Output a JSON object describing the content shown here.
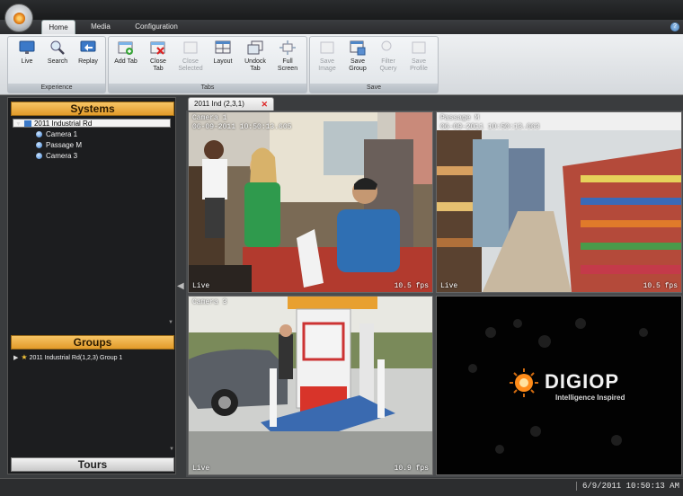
{
  "ribbon_tabs": [
    {
      "label": "Home"
    },
    {
      "label": "Media"
    },
    {
      "label": "Configuration"
    }
  ],
  "help_label": "?",
  "ribbon_groups": {
    "experience": {
      "label": "Experience",
      "buttons": [
        {
          "label": "Live",
          "icon": "monitor-icon"
        },
        {
          "label": "Search",
          "icon": "magnifier-icon"
        },
        {
          "label": "Replay",
          "icon": "replay-icon"
        }
      ]
    },
    "tabs": {
      "label": "Tabs",
      "buttons": [
        {
          "label": "Add Tab",
          "icon": "add-tab-icon"
        },
        {
          "label": "Close Tab",
          "icon": "close-tab-icon"
        },
        {
          "label": "Close Selected",
          "icon": "close-selected-icon"
        },
        {
          "label": "Layout",
          "icon": "layout-icon"
        },
        {
          "label": "Undock Tab",
          "icon": "undock-icon"
        },
        {
          "label": "Full Screen",
          "icon": "fullscreen-icon"
        }
      ]
    },
    "save": {
      "label": "Save",
      "buttons": [
        {
          "label": "Save Image",
          "icon": "save-image-icon"
        },
        {
          "label": "Save Group",
          "icon": "save-group-icon"
        },
        {
          "label": "Filter Query",
          "icon": "filter-icon"
        },
        {
          "label": "Save Profile",
          "icon": "save-profile-icon"
        }
      ]
    }
  },
  "systems": {
    "header": "Systems",
    "site": "2011 Industrial Rd",
    "cameras": [
      "Camera 1",
      "Passage M",
      "Camera 3"
    ]
  },
  "groups": {
    "header": "Groups",
    "item": "2011 Industrial Rd(1,2,3) Group 1"
  },
  "tours": {
    "header": "Tours"
  },
  "video_tab": {
    "label": "2011 Ind (2,3,1)",
    "close": "✕"
  },
  "tiles": [
    {
      "name": "Camera 1",
      "timestamp": "06-09-2011 10:50:13.605",
      "mode": "Live",
      "fps": "10.5 fps"
    },
    {
      "name": "Passage M",
      "timestamp": "06-09-2011 10:50:13.663",
      "mode": "Live",
      "fps": "10.5 fps"
    },
    {
      "name": "Camera 3",
      "timestamp": "",
      "mode": "Live",
      "fps": "10.9 fps"
    }
  ],
  "logo": {
    "brand": "DIGIOP",
    "tagline": "Intelligence Inspired"
  },
  "status": {
    "datetime": "6/9/2011 10:50:13 AM"
  },
  "colors": {
    "accent": "#e8a43a",
    "selection": "#ffffff",
    "live_text": "#ffffff"
  }
}
